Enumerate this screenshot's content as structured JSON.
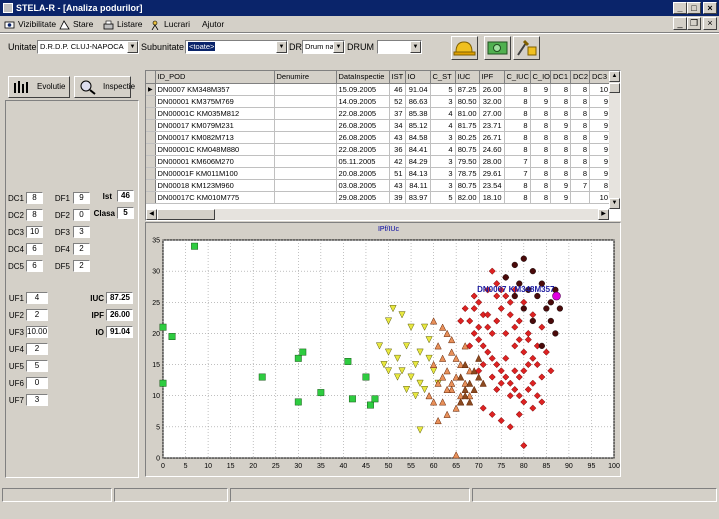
{
  "window": {
    "title": "STELA-R - [Analiza podurilor]",
    "minimize": "_",
    "maximize": "□",
    "close": "×"
  },
  "menu": {
    "items": [
      "Vizibilitate",
      "Stare",
      "Listare",
      "Lucrari",
      "Ajutor"
    ],
    "mdi_minimize": "_",
    "mdi_restore": "❐",
    "mdi_close": "×"
  },
  "filters": {
    "unitate_label": "Unitate",
    "unitate_value": "D.R.D.P. CLUJ-NAPOCA",
    "subunitate_label": "Subunitate",
    "subunitate_value": "<toate>",
    "dr_label": "DR",
    "dr_value": "Drum na",
    "drum_label": "DRUM",
    "drum_value": ""
  },
  "toolbar": {
    "buttons": [
      "hardhat-icon",
      "money-icon",
      "tools-icon"
    ]
  },
  "left": {
    "evolutie_label": "Evolutie",
    "inspectie_label": "Inspectie",
    "dc": [
      {
        "label": "DC1",
        "value": "8"
      },
      {
        "label": "DC2",
        "value": "8"
      },
      {
        "label": "DC3",
        "value": "10"
      },
      {
        "label": "DC4",
        "value": "6"
      },
      {
        "label": "DC5",
        "value": "6"
      }
    ],
    "df": [
      {
        "label": "DF1",
        "value": "9"
      },
      {
        "label": "DF2",
        "value": "0"
      },
      {
        "label": "DF3",
        "value": "3"
      },
      {
        "label": "DF4",
        "value": "2"
      },
      {
        "label": "DF5",
        "value": "2"
      }
    ],
    "ist_label": "Ist",
    "ist_value": "46",
    "clasa_label": "Clasa",
    "clasa_value": "5",
    "uf": [
      {
        "label": "UF1",
        "value": "4"
      },
      {
        "label": "UF2",
        "value": "2"
      },
      {
        "label": "UF3",
        "value": "10.00"
      },
      {
        "label": "UF4",
        "value": "2"
      },
      {
        "label": "UF5",
        "value": "5"
      },
      {
        "label": "UF6",
        "value": "0"
      },
      {
        "label": "UF7",
        "value": "3"
      }
    ],
    "iuc_label": "IUC",
    "iuc_value": "87.25",
    "ipf_label": "IPF",
    "ipf_value": "26.00",
    "io_label": "IO",
    "io_value": "91.04"
  },
  "table": {
    "columns": [
      "ID_POD",
      "Denumire",
      "DataInspectie",
      "IST",
      "IO",
      "C_ST",
      "IUC",
      "IPF",
      "C_IUC",
      "C_IO",
      "DC1",
      "DC2",
      "DC3"
    ],
    "rows": [
      [
        "DN0007  KM348M357",
        "",
        "15.09.2005",
        "46",
        "91.04",
        "5",
        "87.25",
        "26.00",
        "8",
        "9",
        "8",
        "8",
        "10"
      ],
      [
        "DN00001  KM375M769",
        "",
        "14.09.2005",
        "52",
        "86.63",
        "3",
        "80.50",
        "32.00",
        "8",
        "9",
        "8",
        "8",
        "9"
      ],
      [
        "DN00001C KM035M812",
        "",
        "22.08.2005",
        "37",
        "85.38",
        "4",
        "81.00",
        "27.00",
        "8",
        "8",
        "8",
        "8",
        "9"
      ],
      [
        "DN00017  KM079M231",
        "",
        "26.08.2005",
        "34",
        "85.12",
        "4",
        "81.75",
        "23.71",
        "8",
        "8",
        "9",
        "8",
        "9"
      ],
      [
        "DN00017  KM082M713",
        "",
        "26.08.2005",
        "43",
        "84.58",
        "3",
        "80.25",
        "26.71",
        "8",
        "8",
        "8",
        "8",
        "9"
      ],
      [
        "DN00001C KM048M880",
        "",
        "22.08.2005",
        "36",
        "84.41",
        "4",
        "80.75",
        "24.60",
        "8",
        "8",
        "8",
        "8",
        "9"
      ],
      [
        "DN00001  KM606M270",
        "",
        "05.11.2005",
        "42",
        "84.29",
        "3",
        "79.50",
        "28.00",
        "7",
        "8",
        "8",
        "8",
        "9"
      ],
      [
        "DN00001F KM011M100",
        "",
        "20.08.2005",
        "51",
        "84.13",
        "3",
        "78.75",
        "29.61",
        "7",
        "8",
        "8",
        "8",
        "9"
      ],
      [
        "DN00018  KM123M960",
        "",
        "03.08.2005",
        "43",
        "84.11",
        "3",
        "80.75",
        "23.54",
        "8",
        "8",
        "9",
        "7",
        "8"
      ],
      [
        "DN00017C KM010M775",
        "",
        "29.08.2005",
        "39",
        "83.97",
        "5",
        "82.00",
        "18.10",
        "8",
        "8",
        "9",
        "",
        "10"
      ]
    ]
  },
  "chart_data": {
    "type": "scatter",
    "title": "IPf/IUc",
    "xlim": [
      0,
      100
    ],
    "ylim": [
      0,
      35
    ],
    "xticks": [
      0,
      5,
      10,
      15,
      20,
      25,
      30,
      35,
      40,
      45,
      50,
      55,
      60,
      65,
      70,
      75,
      80,
      85,
      90,
      95,
      100
    ],
    "yticks": [
      0,
      5,
      10,
      15,
      20,
      25,
      30,
      35
    ],
    "grid": true,
    "highlight": {
      "label": "DN0007  KM348M357",
      "x": 87.25,
      "y": 26.0,
      "color": "#e000e0"
    },
    "groups": [
      {
        "marker": "square",
        "color": "#2ecc40",
        "points": [
          [
            7,
            34
          ],
          [
            0,
            21
          ],
          [
            2,
            19.5
          ],
          [
            0,
            12
          ],
          [
            22,
            13
          ],
          [
            30,
            16
          ],
          [
            31,
            17
          ],
          [
            35,
            10.5
          ],
          [
            41,
            15.5
          ],
          [
            42,
            9.5
          ],
          [
            45,
            13
          ],
          [
            46,
            8.5
          ],
          [
            47,
            9.5
          ],
          [
            30,
            9
          ]
        ]
      },
      {
        "marker": "triangle-down",
        "color": "#e8e840",
        "points": [
          [
            50,
            22
          ],
          [
            51,
            24
          ],
          [
            53,
            23
          ],
          [
            55,
            21
          ],
          [
            48,
            18
          ],
          [
            50,
            17
          ],
          [
            52,
            16
          ],
          [
            54,
            18
          ],
          [
            56,
            15
          ],
          [
            55,
            13
          ],
          [
            53,
            14
          ],
          [
            57,
            12
          ],
          [
            58,
            11
          ],
          [
            56,
            10
          ],
          [
            59,
            16
          ],
          [
            60,
            14
          ],
          [
            61,
            12
          ],
          [
            57,
            17
          ],
          [
            59,
            19
          ],
          [
            58,
            21
          ],
          [
            57,
            4.5
          ],
          [
            54,
            11
          ],
          [
            52,
            13
          ],
          [
            50,
            14
          ],
          [
            49,
            15
          ]
        ]
      },
      {
        "marker": "triangle-up",
        "color": "#e8905a",
        "points": [
          [
            60,
            22
          ],
          [
            62,
            21
          ],
          [
            63,
            20
          ],
          [
            61,
            18
          ],
          [
            64,
            17
          ],
          [
            62,
            16
          ],
          [
            60,
            15
          ],
          [
            63,
            14
          ],
          [
            65,
            13
          ],
          [
            61,
            12
          ],
          [
            64,
            11
          ],
          [
            66,
            10
          ],
          [
            62,
            9
          ],
          [
            65,
            8
          ],
          [
            63,
            7
          ],
          [
            67,
            12
          ],
          [
            66,
            15
          ],
          [
            68,
            14
          ],
          [
            64,
            19
          ],
          [
            59,
            10
          ],
          [
            62,
            13
          ],
          [
            65,
            16
          ],
          [
            67,
            18
          ],
          [
            61,
            6
          ],
          [
            65,
            0.5
          ],
          [
            60,
            9
          ],
          [
            64,
            12
          ],
          [
            66,
            9
          ],
          [
            68,
            10
          ],
          [
            63,
            11
          ]
        ]
      },
      {
        "marker": "triangle-up",
        "color": "#8b4a20",
        "points": [
          [
            66,
            13
          ],
          [
            67,
            11
          ],
          [
            68,
            12
          ],
          [
            69,
            14
          ],
          [
            67,
            15
          ],
          [
            70,
            13
          ],
          [
            68,
            9
          ],
          [
            69,
            11
          ],
          [
            70,
            16
          ],
          [
            71,
            12
          ],
          [
            66,
            9
          ],
          [
            67,
            10
          ]
        ]
      },
      {
        "marker": "diamond",
        "color": "#dd2222",
        "points": [
          [
            68,
            22
          ],
          [
            69,
            24
          ],
          [
            70,
            25
          ],
          [
            71,
            23
          ],
          [
            72,
            21
          ],
          [
            73,
            20
          ],
          [
            74,
            22
          ],
          [
            75,
            24
          ],
          [
            76,
            26
          ],
          [
            77,
            23
          ],
          [
            78,
            21
          ],
          [
            79,
            19
          ],
          [
            80,
            17
          ],
          [
            81,
            15
          ],
          [
            70,
            19
          ],
          [
            71,
            18
          ],
          [
            72,
            17
          ],
          [
            73,
            16
          ],
          [
            74,
            15
          ],
          [
            75,
            14
          ],
          [
            76,
            13
          ],
          [
            77,
            12
          ],
          [
            78,
            11
          ],
          [
            79,
            10
          ],
          [
            80,
            9
          ],
          [
            71,
            8
          ],
          [
            73,
            7
          ],
          [
            75,
            6
          ],
          [
            77,
            5
          ],
          [
            79,
            7
          ],
          [
            72,
            27
          ],
          [
            74,
            28
          ],
          [
            76,
            29
          ],
          [
            78,
            27
          ],
          [
            80,
            25
          ],
          [
            82,
            23
          ],
          [
            81,
            20
          ],
          [
            83,
            18
          ],
          [
            82,
            16
          ],
          [
            84,
            21
          ],
          [
            69,
            20
          ],
          [
            70,
            21
          ],
          [
            72,
            23
          ],
          [
            74,
            26
          ],
          [
            76,
            20
          ],
          [
            78,
            18
          ],
          [
            80,
            14
          ],
          [
            82,
            12
          ],
          [
            70,
            14
          ],
          [
            68,
            18
          ],
          [
            66,
            22
          ],
          [
            67,
            24
          ],
          [
            69,
            26
          ],
          [
            73,
            30
          ],
          [
            75,
            27
          ],
          [
            77,
            25
          ],
          [
            79,
            22
          ],
          [
            81,
            19
          ],
          [
            83,
            15
          ],
          [
            80,
            2
          ],
          [
            74,
            11
          ],
          [
            76,
            16
          ],
          [
            78,
            14
          ],
          [
            71,
            15
          ],
          [
            73,
            13
          ],
          [
            75,
            12
          ],
          [
            77,
            10
          ],
          [
            79,
            13
          ],
          [
            81,
            11
          ],
          [
            84,
            13
          ],
          [
            85,
            17
          ],
          [
            86,
            14
          ],
          [
            83,
            10
          ],
          [
            82,
            8
          ],
          [
            84,
            9
          ]
        ]
      },
      {
        "marker": "circle",
        "color": "#4a0a0a",
        "points": [
          [
            76,
            29
          ],
          [
            78,
            31
          ],
          [
            80,
            32
          ],
          [
            82,
            30
          ],
          [
            84,
            28
          ],
          [
            83,
            26
          ],
          [
            81,
            27
          ],
          [
            79,
            28
          ],
          [
            85,
            24
          ],
          [
            86,
            22
          ],
          [
            87,
            20
          ],
          [
            84,
            18
          ],
          [
            82,
            22
          ],
          [
            80,
            24
          ],
          [
            78,
            26
          ],
          [
            86,
            25
          ],
          [
            88,
            24
          ],
          [
            87,
            27
          ]
        ]
      }
    ]
  },
  "status": {
    "panels": [
      "",
      "",
      "",
      ""
    ]
  }
}
